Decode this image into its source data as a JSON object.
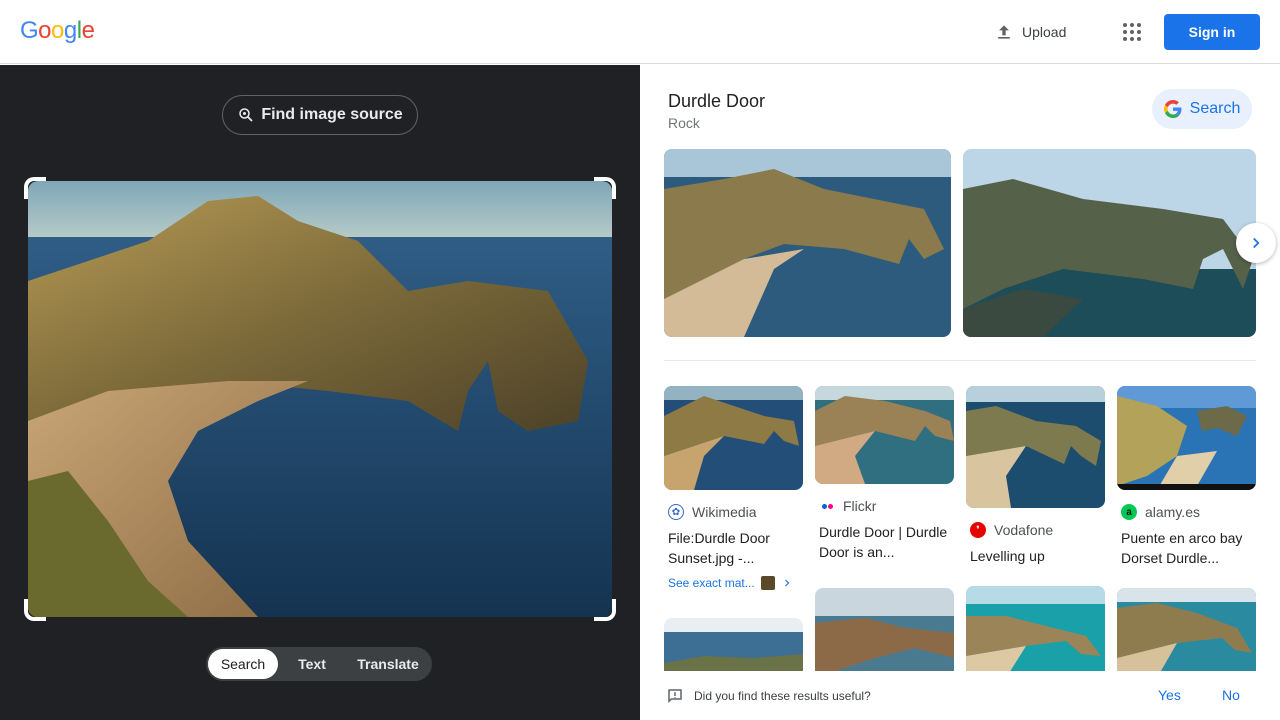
{
  "header": {
    "logo": [
      "G",
      "o",
      "o",
      "g",
      "l",
      "e"
    ],
    "logo_colors": [
      "#4285F4",
      "#EA4335",
      "#FBBC05",
      "#4285F4",
      "#34A853",
      "#EA4335"
    ],
    "upload_label": "Upload",
    "signin_label": "Sign in",
    "apps_icon": "apps-grid-icon",
    "upload_icon": "upload-icon"
  },
  "left": {
    "find_source_label": "Find image source",
    "find_source_icon": "lens-search-icon",
    "modes": [
      "Search",
      "Text",
      "Translate"
    ],
    "active_mode": "Search"
  },
  "right": {
    "title": "Durdle Door",
    "subtitle": "Rock",
    "search_label": "Search",
    "results": [
      {
        "source": "Wikimedia",
        "title": "File:Durdle Door Sunset.jpg -...",
        "see_exact": "See exact mat...",
        "icon_color": "#3366cc"
      },
      {
        "source": "Flickr",
        "title": "Durdle Door | Durdle Door is an...",
        "icon_color": "#0063dc"
      },
      {
        "source": "Vodafone",
        "title": "Levelling up",
        "icon_color": "#e60000"
      },
      {
        "source": "alamy.es",
        "title": "Puente en arco bay Dorset Durdle...",
        "icon_color": "#00c853"
      }
    ]
  },
  "feedback": {
    "question": "Did you find these results useful?",
    "yes": "Yes",
    "no": "No"
  },
  "colors": {
    "accent": "#1a73e8",
    "dark_bg": "#202124"
  }
}
